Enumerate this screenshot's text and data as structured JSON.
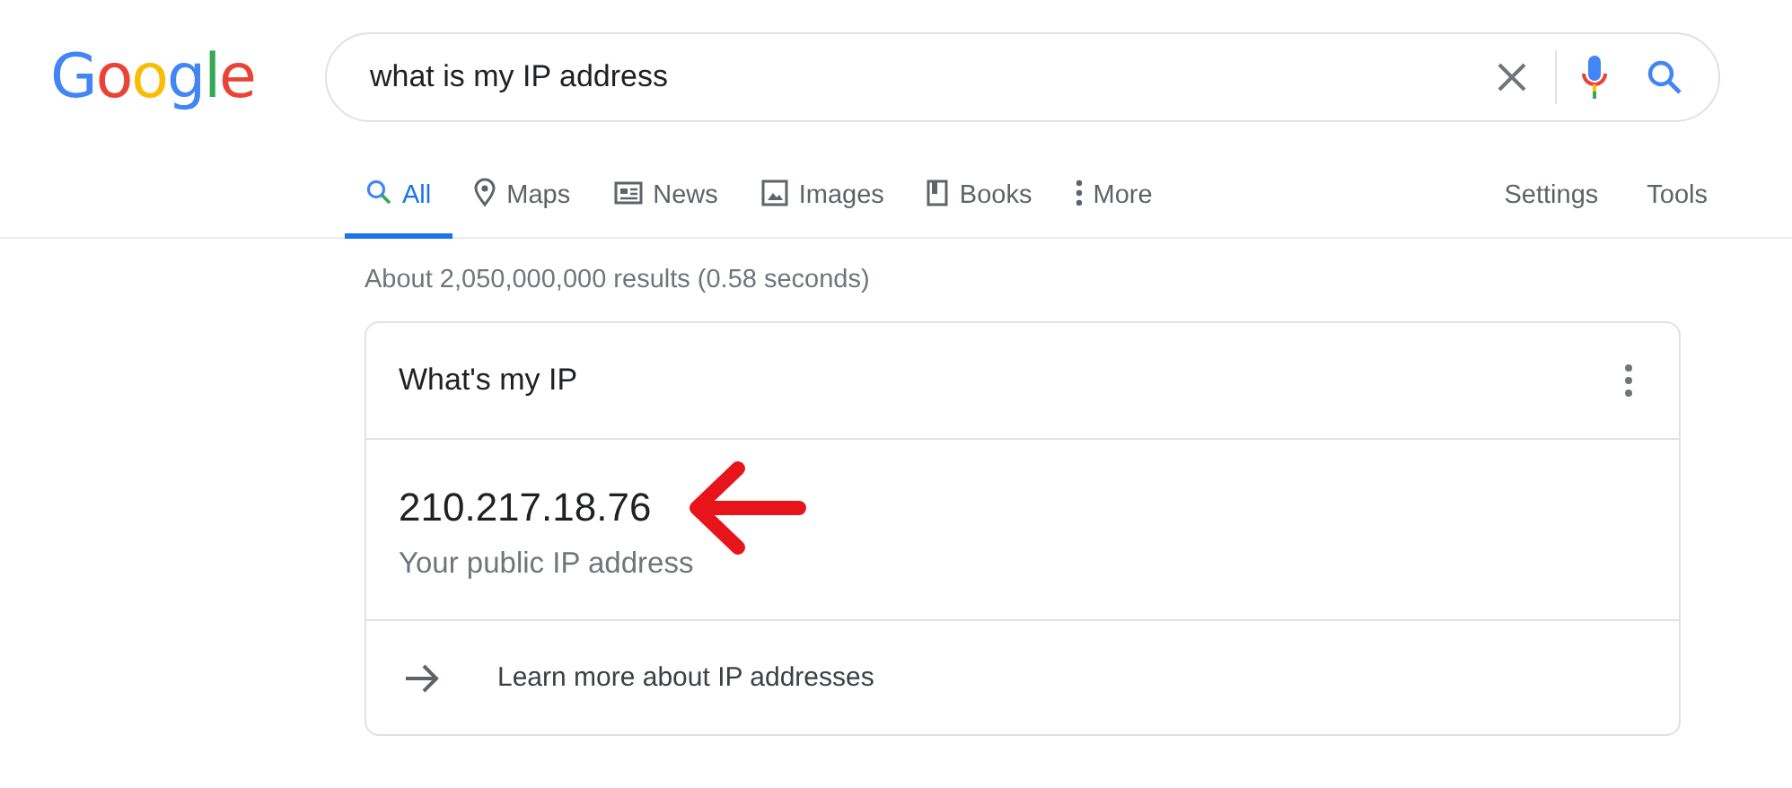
{
  "logo": {
    "text": "Google"
  },
  "search": {
    "value": "what is my IP address"
  },
  "tabs": [
    {
      "label": "All",
      "selected": true
    },
    {
      "label": "Maps",
      "selected": false
    },
    {
      "label": "News",
      "selected": false
    },
    {
      "label": "Images",
      "selected": false
    },
    {
      "label": "Books",
      "selected": false
    },
    {
      "label": "More",
      "selected": false
    }
  ],
  "tools": [
    "Settings",
    "Tools"
  ],
  "result_stats": "About 2,050,000,000 results (0.58 seconds)",
  "card": {
    "title": "What's my IP",
    "ip": "210.217.18.76",
    "caption": "Your public IP address",
    "link": "Learn more about IP addresses"
  }
}
